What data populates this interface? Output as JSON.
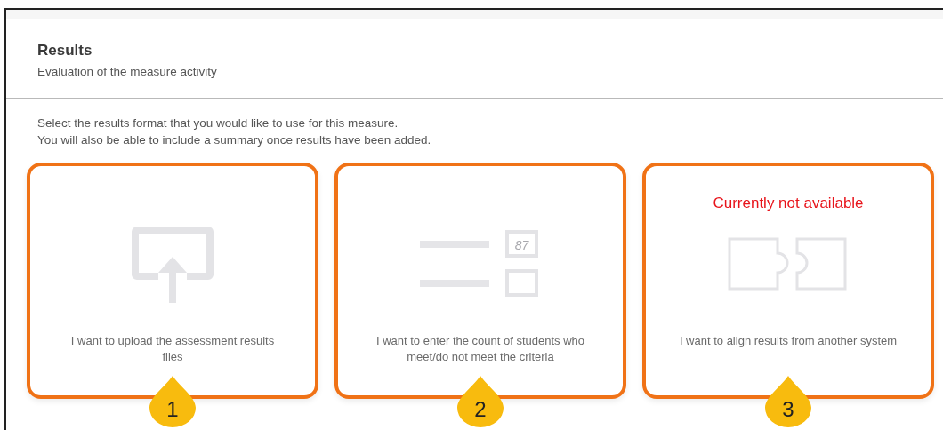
{
  "header": {
    "title": "Results",
    "subtitle": "Evaluation of the measure activity"
  },
  "instructions": [
    "Select the results format that you would like to use for this measure.",
    "You will also be able to include a summary once results have been added."
  ],
  "options": [
    {
      "kind": "upload",
      "label": "I want to upload the assessment results files",
      "highlighted": true,
      "callout": "1"
    },
    {
      "kind": "count",
      "label": "I want to enter the count of students who meet/do not meet the criteria",
      "icon_value": "87",
      "highlighted": true,
      "callout": "2"
    },
    {
      "kind": "align",
      "label": "I want to align results from another system",
      "notice": "Currently not available",
      "highlighted": true,
      "callout": "3"
    }
  ]
}
